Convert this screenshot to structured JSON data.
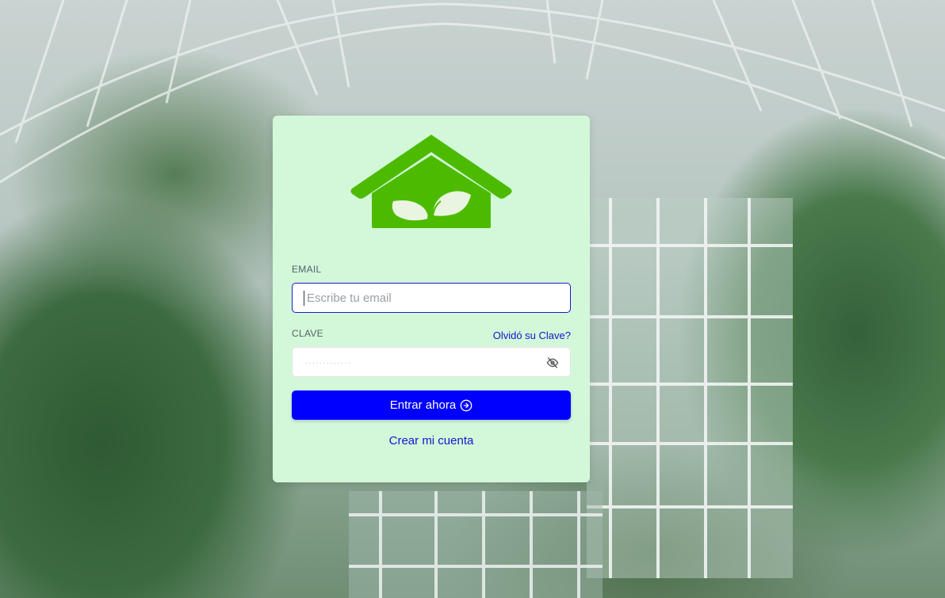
{
  "login": {
    "email_label": "EMAIL",
    "email_placeholder": "Escribe tu email",
    "email_value": "",
    "password_label": "CLAVE",
    "password_mask": "·············",
    "forgot_link": "Olvidó su Clave?",
    "submit_label": "Entrar ahora",
    "create_account_link": "Crear mi cuenta"
  },
  "icons": {
    "logo": "greenhouse-house-leaf-logo",
    "password_toggle": "eye-off-icon",
    "submit_arrow": "arrow-circle-right-icon"
  },
  "colors": {
    "card_background": "#d3f8d9",
    "primary_button": "#0000ff",
    "link": "#1414cc",
    "logo_green": "#4cbb00",
    "input_focus_border": "#1a1acc"
  }
}
